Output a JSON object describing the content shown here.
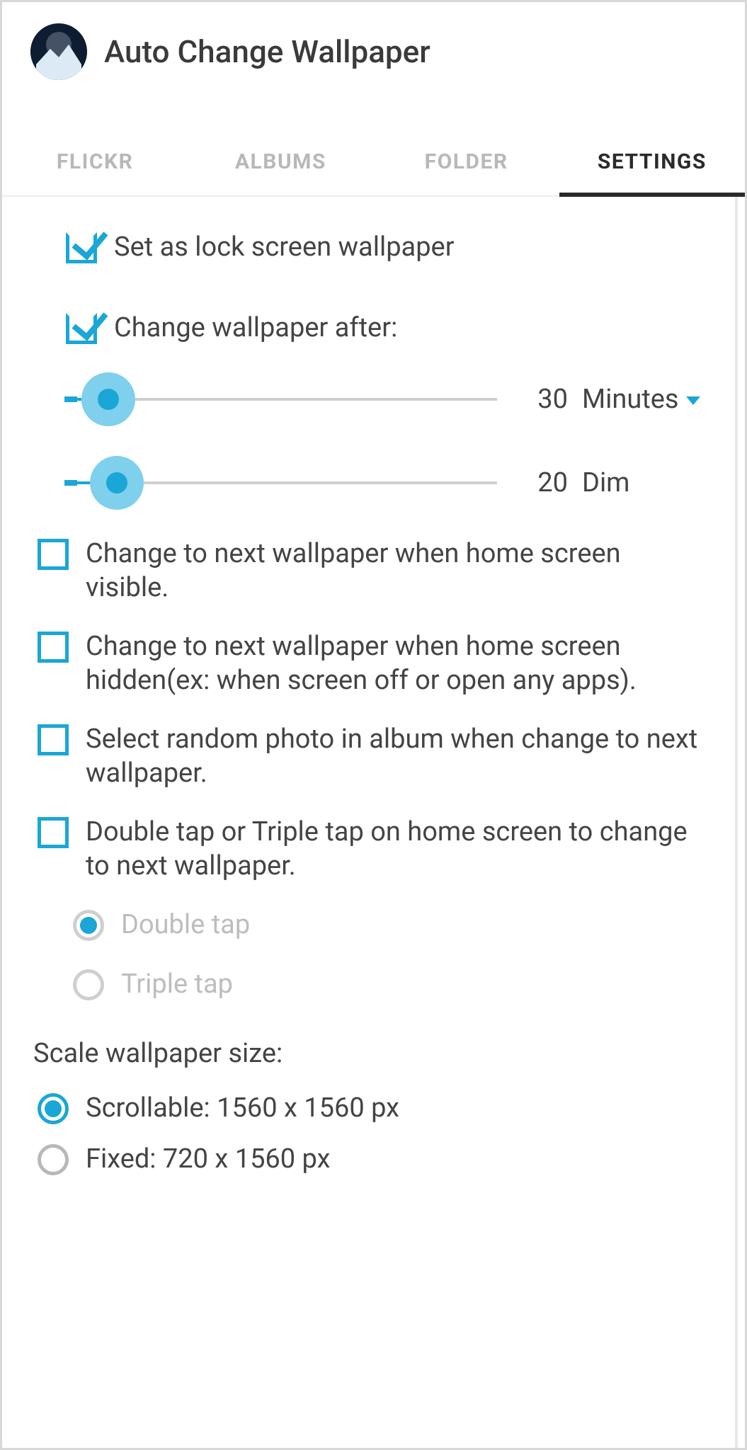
{
  "header": {
    "title": "Auto Change Wallpaper"
  },
  "tabs": {
    "items": [
      {
        "label": "FLICKR"
      },
      {
        "label": "ALBUMS"
      },
      {
        "label": "FOLDER"
      },
      {
        "label": "SETTINGS"
      }
    ],
    "active_index": 3
  },
  "settings": {
    "set_lock_screen": {
      "label": "Set as lock screen wallpaper",
      "checked": true
    },
    "change_after": {
      "label": "Change wallpaper after:",
      "checked": true,
      "interval": {
        "value": 30,
        "unit": "Minutes",
        "percent": 8
      },
      "dim": {
        "value": 20,
        "unit": "Dim",
        "percent": 10
      }
    },
    "on_home_visible": {
      "label": "Change to next wallpaper when home screen visible.",
      "checked": false
    },
    "on_home_hidden": {
      "label": "Change to next wallpaper when home screen hidden(ex: when screen off or open any apps).",
      "checked": false
    },
    "random_photo": {
      "label": "Select random photo in album when change to next wallpaper.",
      "checked": false
    },
    "tap_change": {
      "label": "Double tap or Triple tap on home screen to change to next wallpaper.",
      "checked": false
    },
    "tap_mode": {
      "double": "Double tap",
      "triple": "Triple tap",
      "selected": "double",
      "enabled": false
    },
    "scale": {
      "title": "Scale wallpaper size:",
      "scrollable": "Scrollable: 1560 x 1560 px",
      "fixed": "Fixed: 720 x 1560 px",
      "selected": "scrollable"
    }
  }
}
